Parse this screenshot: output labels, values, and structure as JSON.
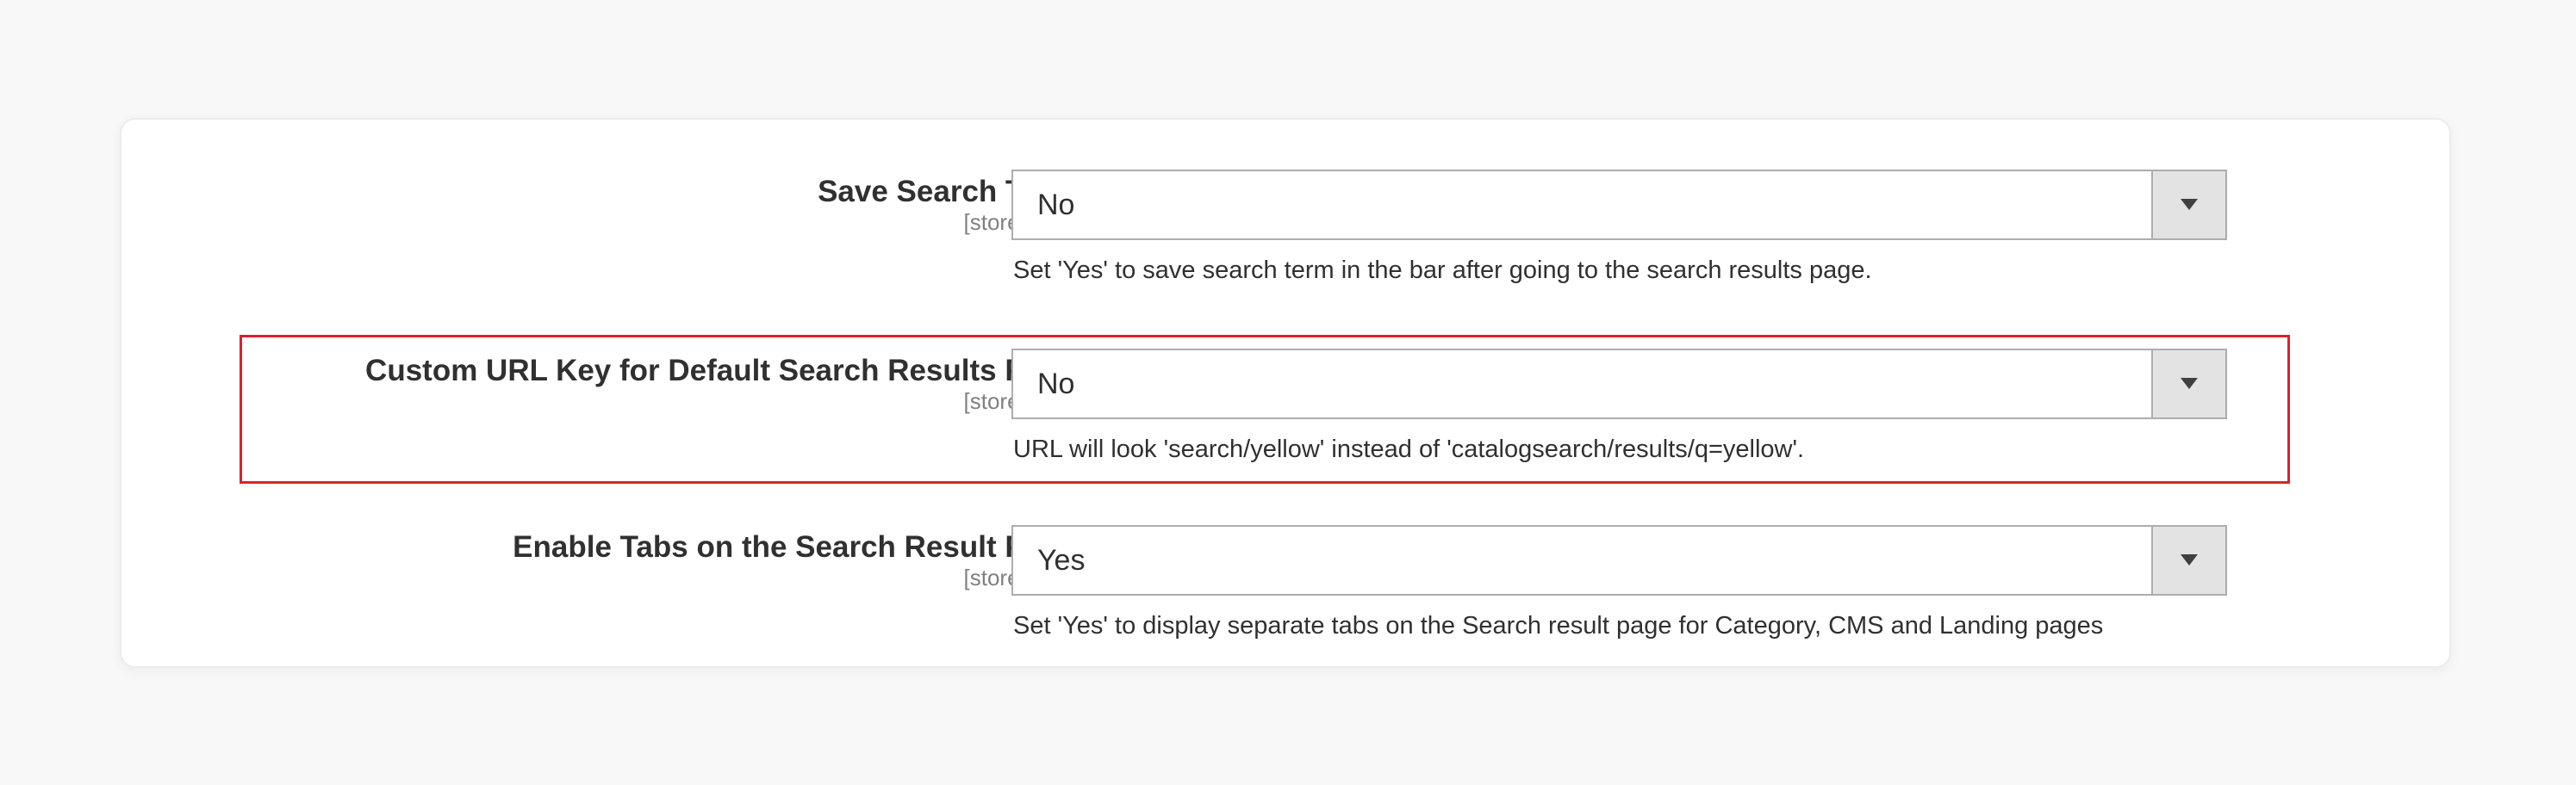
{
  "colors": {
    "highlight_border": "#e0202c",
    "page_background": "#f8f8f8",
    "card_background": "#ffffff",
    "select_arrow_bg": "#e3e3e3"
  },
  "settings": [
    {
      "label": "Save Search Term",
      "scope": "[store view]",
      "value": "No",
      "note": "Set 'Yes' to save search term in the bar after going to the search results page.",
      "icon": "chevron-down-icon"
    },
    {
      "label": "Custom URL Key for Default Search Results Page",
      "scope": "[store view]",
      "value": "No",
      "note": "URL will look 'search/yellow' instead of 'catalogsearch/results/q=yellow'.",
      "icon": "chevron-down-icon",
      "highlighted": true
    },
    {
      "label": "Enable Tabs on the Search Result Page",
      "scope": "[store view]",
      "value": "Yes",
      "note": "Set 'Yes' to display separate tabs on the Search result page for Category, CMS and Landing pages",
      "icon": "chevron-down-icon"
    }
  ]
}
